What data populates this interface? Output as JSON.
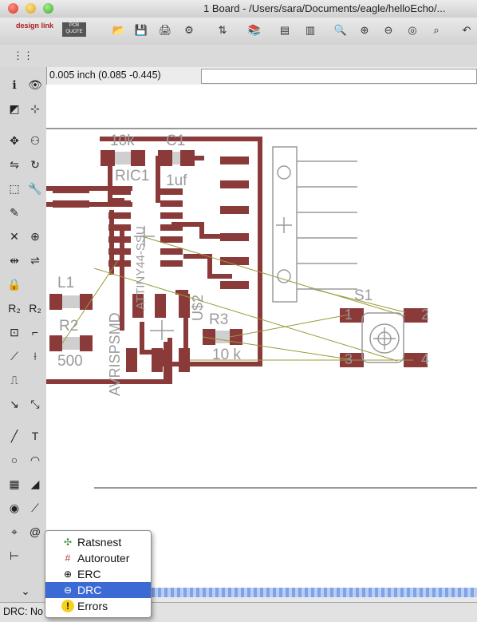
{
  "window": {
    "title": "1 Board - /Users/sara/Documents/eagle/helloEcho/..."
  },
  "toolbar": {
    "designlink_logo": "design link",
    "pcbquote_logo": "PCB QUOTE",
    "buttons": [
      "open-icon",
      "save-icon",
      "print-icon",
      "cam-icon",
      "switch-schematic-icon",
      "library-icon",
      "script-icon",
      "ulp-icon",
      "zoom-fit-icon",
      "zoom-in-icon",
      "zoom-out-icon",
      "zoom-redraw-icon",
      "zoom-select-icon",
      "undo-icon"
    ]
  },
  "coordinates": {
    "readout": "0.005 inch (0.085 -0.445)"
  },
  "command_input": {
    "value": ""
  },
  "board": {
    "labels": {
      "r_10k": "10k",
      "c1": "C1",
      "c1_val": "1uf",
      "ric1": "RIC1",
      "l1": "L1",
      "r2": "R2",
      "r2_val": "500",
      "r3": "R3",
      "r3_val": "10 k",
      "s1": "S1",
      "us2": "U$2",
      "avrispsmd": "AVRISPSMD",
      "ic_name": "ATTINY44-SSU",
      "s1_pin1": "1",
      "s1_pin2": "2",
      "s1_pin3": "3",
      "s1_pin4": "4"
    },
    "colors": {
      "copper": "#8b3a3a",
      "ratsnest": "#9a9a3a",
      "silk": "#9a9a9a"
    }
  },
  "popup_menu": {
    "items": [
      {
        "label": "Ratsnest",
        "icon": "ratsnest-icon",
        "selected": false
      },
      {
        "label": "Autorouter",
        "icon": "autorouter-icon",
        "selected": false
      },
      {
        "label": "ERC",
        "icon": "erc-icon",
        "selected": false
      },
      {
        "label": "DRC",
        "icon": "drc-icon",
        "selected": true
      },
      {
        "label": "Errors",
        "icon": "errors-icon",
        "selected": false
      }
    ]
  },
  "status": {
    "text": "DRC: No"
  }
}
